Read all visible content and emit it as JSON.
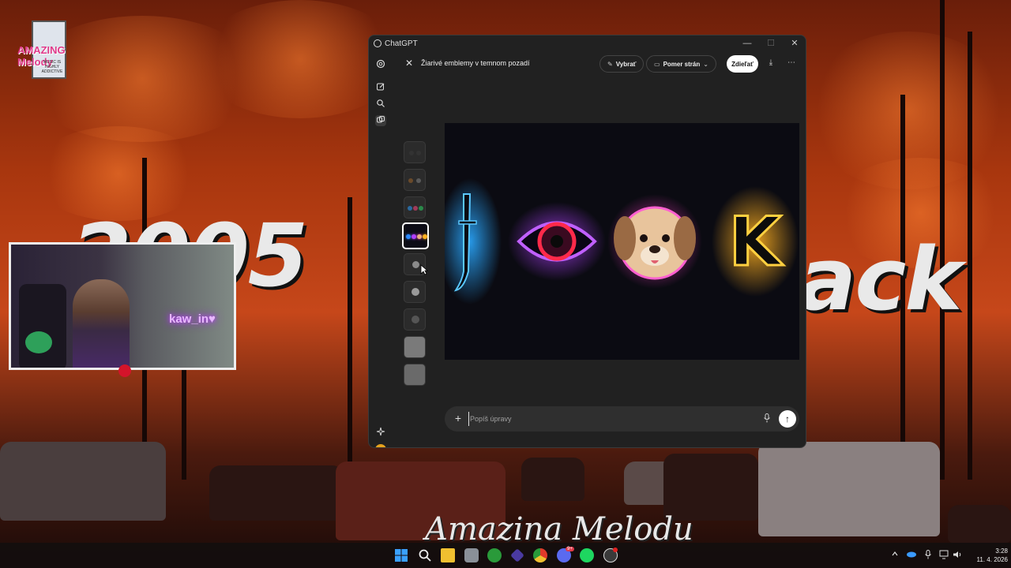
{
  "wallpaper": {
    "big_left": "2005",
    "big_right": "ack",
    "logo_text": "AMAZING Melody",
    "logo_sub": "MUSIC IS HIGHLY ADDICTIVE",
    "watermark": "Amazina Melodu"
  },
  "webcam": {
    "neon_sign": "kaw_in♥"
  },
  "window": {
    "app_title": "ChatGPT",
    "controls": {
      "minimize": "—",
      "maximize": "☐",
      "close": "✕"
    },
    "toolbar": {
      "close_icon": "✕",
      "title": "Žiarivé emblemy v temnom pozadí",
      "select_label": "Vybrať",
      "aspect_label": "Pomer strán",
      "share_label": "Zdieľať",
      "download_icon": "⤓",
      "more_icon": "⋯"
    },
    "sidebar": {
      "icons": [
        "openai-logo-icon",
        "new-chat-icon",
        "search-icon",
        "library-icon",
        "sparkle-icon"
      ]
    },
    "main_image": {
      "emblems": [
        "sword",
        "eye",
        "dog",
        "K"
      ],
      "letter": "K"
    },
    "composer": {
      "placeholder": "Popíš úpravy",
      "plus": "+",
      "mic": "🎤",
      "send": "↑"
    }
  },
  "taskbar": {
    "apps": [
      "windows-start",
      "search",
      "file-explorer",
      "photos",
      "xbox",
      "proton-vpn",
      "chrome",
      "discord",
      "spotify",
      "obs"
    ],
    "time": "3:28",
    "date": "11. 4. 2026",
    "discord_badge": "9+"
  },
  "colors": {
    "accent_white": "#ffffff",
    "window_bg": "#212121",
    "glow_blue": "#2aa8ff",
    "glow_purple": "#b040ff",
    "glow_pink": "#ff40c8",
    "glow_gold": "#ffb020"
  }
}
